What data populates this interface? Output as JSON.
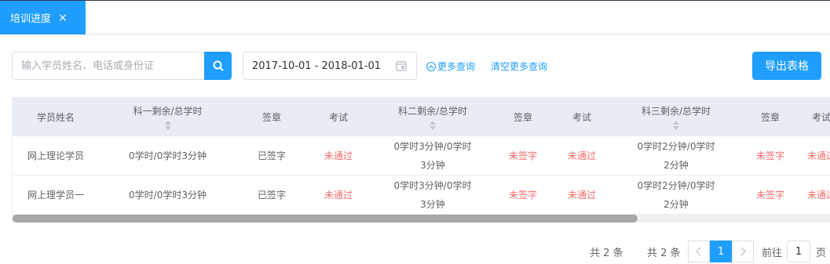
{
  "tabs": [
    {
      "label": "培训进度",
      "close": "×"
    }
  ],
  "search": {
    "placeholder": "输入学员姓名、电话或身份证"
  },
  "date_range": {
    "value": "2017-10-01 - 2018-01-01"
  },
  "links": {
    "more_query": "更多查询",
    "clear_query": "清空更多查询"
  },
  "export_label": "导出表格",
  "table": {
    "headers": [
      "学员姓名",
      "科一剩余/总学时",
      "签章",
      "考试",
      "科二剩余/总学时",
      "签章",
      "考试",
      "科三剩余/总学时",
      "签章",
      "考试"
    ],
    "rows": [
      [
        "网上理论学员",
        "0学时/0学时3分钟",
        "已签字",
        "未通过",
        "0学时3分钟/0学时",
        "3分钟",
        "未签字",
        "未通过",
        "0学时2分钟/0学时",
        "2分钟",
        "未签字",
        "未通过"
      ],
      [
        "网上理学员一",
        "0学时/0学时3分钟",
        "已签字",
        "未通过",
        "0学时3分钟/0学时",
        "3分钟",
        "未签字",
        "未通过",
        "0学时2分钟/0学时",
        "2分钟",
        "未签字",
        "未通过"
      ]
    ]
  },
  "pagination": {
    "total_text": "共 2 条",
    "total_text2": "共 2 条",
    "page": "1",
    "goto_prefix": "前往",
    "goto_value": "1",
    "goto_suffix": "页"
  },
  "colors": {
    "accent": "#1f9eff",
    "danger": "#f56c6c",
    "header_bg": "#e9ecf3"
  }
}
